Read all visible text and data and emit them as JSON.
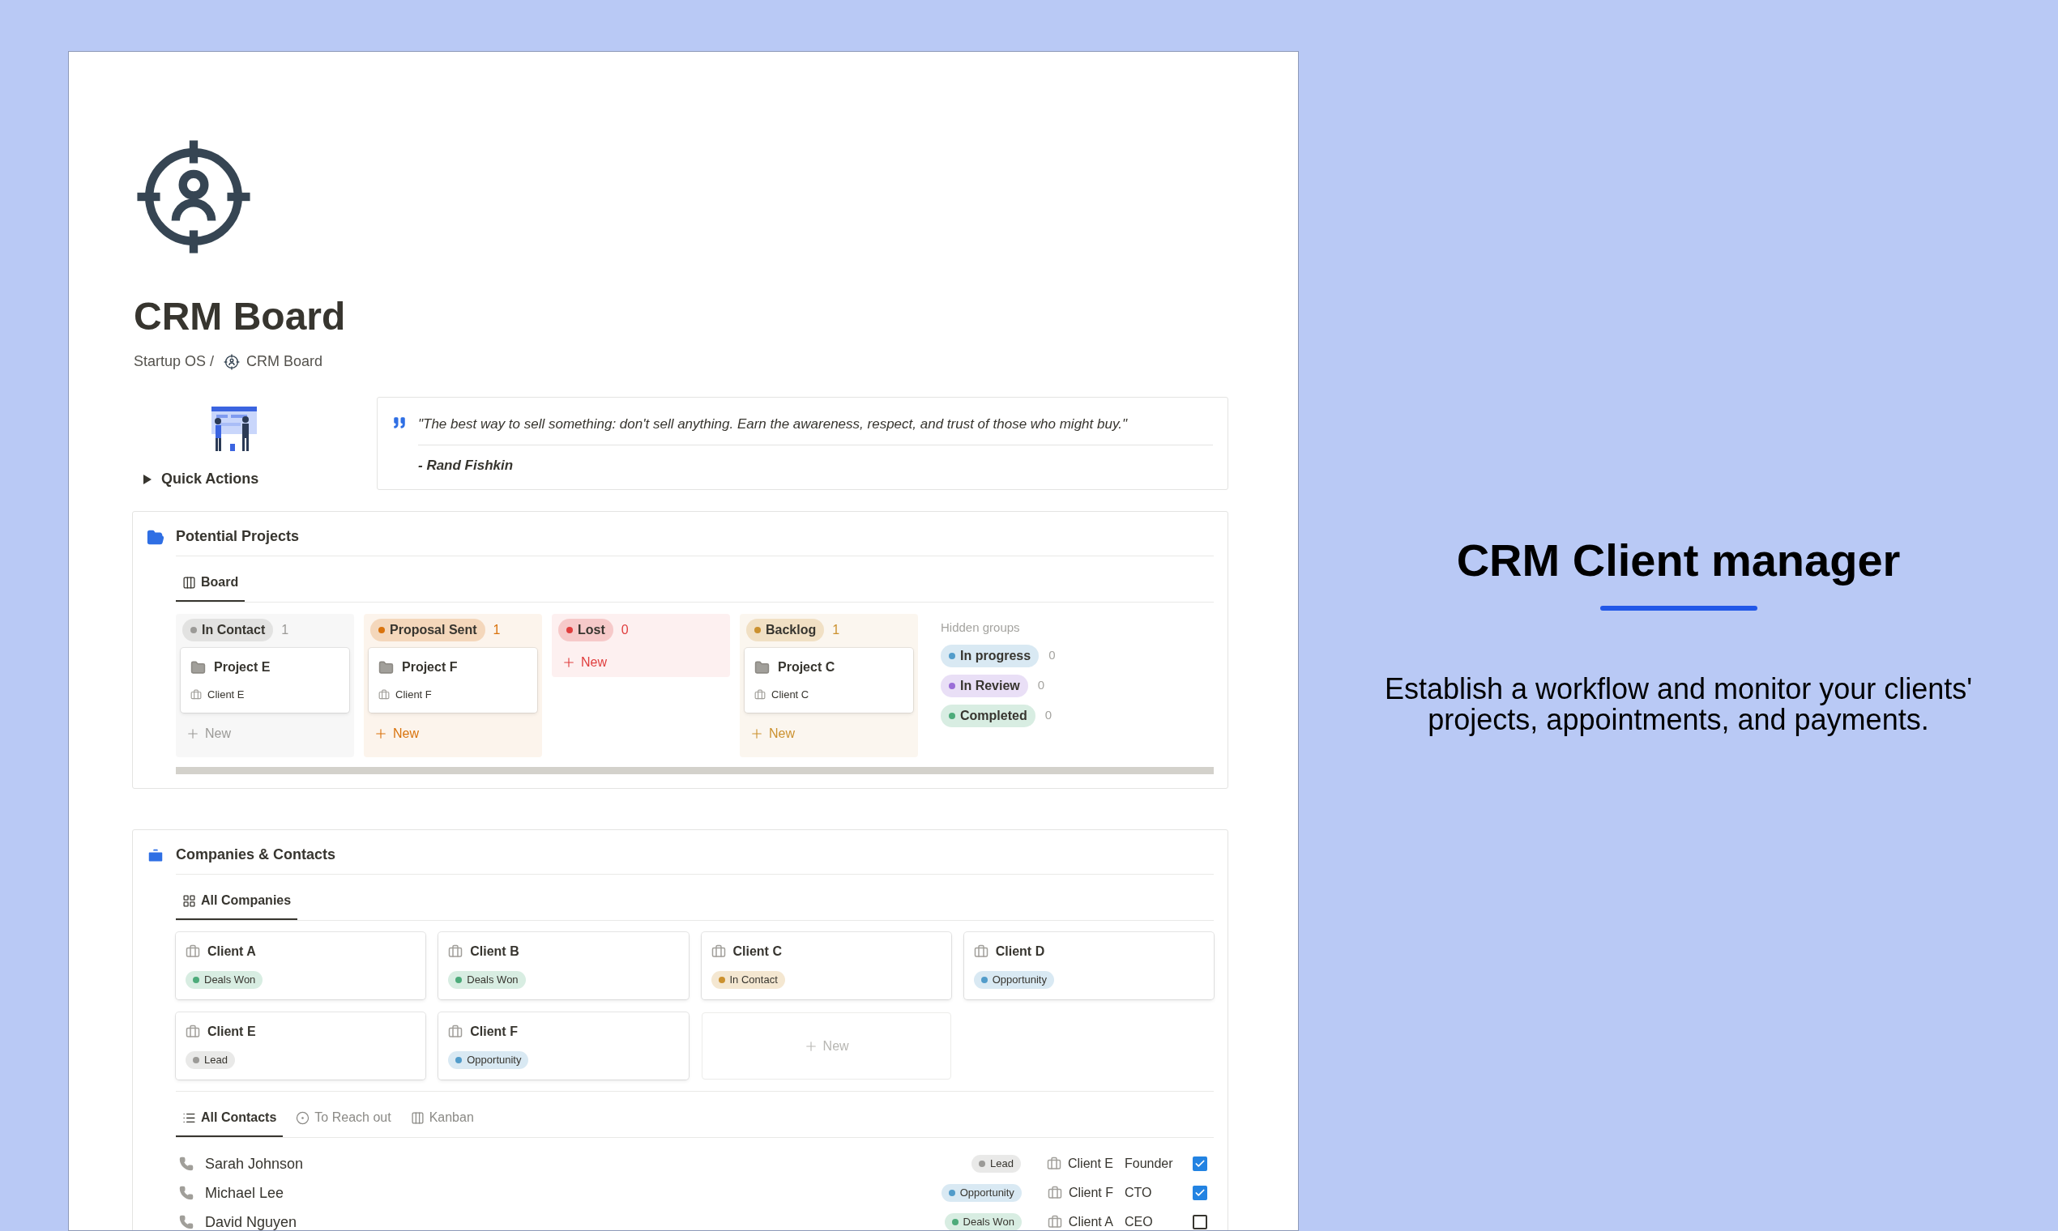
{
  "page": {
    "title": "CRM Board",
    "breadcrumb": [
      {
        "label": "Startup OS /"
      },
      {
        "label": "CRM Board"
      }
    ]
  },
  "quick_actions": {
    "label": "Quick Actions",
    "expanded": false
  },
  "quote": {
    "text": "\"The best way to sell something: don't sell anything. Earn the awareness, respect, and trust of those who might buy.\"",
    "author": "- Rand Fishkin"
  },
  "potential_projects": {
    "title": "Potential Projects",
    "views": [
      {
        "label": "Board",
        "selected": true
      }
    ],
    "groups": [
      {
        "label": "In Contact",
        "count": "1",
        "color": "#9b9a97",
        "cards": [
          {
            "title": "Project E",
            "client": "Client E"
          }
        ],
        "new_label": "New"
      },
      {
        "label": "Proposal Sent",
        "count": "1",
        "color": "#d9730d",
        "cards": [
          {
            "title": "Project F",
            "client": "Client F"
          }
        ],
        "new_label": "New"
      },
      {
        "label": "Lost",
        "count": "0",
        "color": "#e03e3e",
        "new_label": "New"
      },
      {
        "label": "Backlog",
        "count": "1",
        "color": "#cb912f",
        "cards": [
          {
            "title": "Project C",
            "client": "Client C"
          }
        ],
        "new_label": "New"
      }
    ],
    "hidden_groups": {
      "label": "Hidden groups",
      "groups": [
        {
          "label": "In progress",
          "count": "0",
          "color": "#529cca"
        },
        {
          "label": "In Review",
          "count": "0",
          "color": "#9a6dd7"
        },
        {
          "label": "Completed",
          "count": "0",
          "color": "#4dab7a"
        }
      ]
    }
  },
  "companies": {
    "title": "Companies & Contacts",
    "views": [
      {
        "label": "All Companies",
        "selected": true
      }
    ],
    "cards": [
      {
        "name": "Client A",
        "status": {
          "label": "Deals Won",
          "color": "#4dab7a"
        }
      },
      {
        "name": "Client B",
        "status": {
          "label": "Deals Won",
          "color": "#4dab7a"
        }
      },
      {
        "name": "Client C",
        "status": {
          "label": "In Contact",
          "color": "#cb912f"
        }
      },
      {
        "name": "Client D",
        "status": {
          "label": "Opportunity",
          "color": "#529cca"
        }
      },
      {
        "name": "Client E",
        "status": {
          "label": "Lead",
          "color": "#9b9a97"
        }
      },
      {
        "name": "Client F",
        "status": {
          "label": "Opportunity",
          "color": "#529cca"
        }
      }
    ],
    "new_label": "New"
  },
  "contacts": {
    "views": [
      {
        "label": "All Contacts",
        "selected": true,
        "kind": "list"
      },
      {
        "label": "To Reach out",
        "selected": false,
        "kind": "target"
      },
      {
        "label": "Kanban",
        "selected": false,
        "kind": "board"
      }
    ],
    "rows": [
      {
        "name": "Sarah Johnson",
        "status": {
          "label": "Lead",
          "color": "#9b9a97"
        },
        "company": "Client E",
        "role": "Founder",
        "checked": true
      },
      {
        "name": "Michael Lee",
        "status": {
          "label": "Opportunity",
          "color": "#529cca"
        },
        "company": "Client F",
        "role": "CTO",
        "checked": true
      },
      {
        "name": "David Nguyen",
        "status": {
          "label": "Deals Won",
          "color": "#4dab7a"
        },
        "company": "Client A",
        "role": "CEO",
        "checked": false
      }
    ]
  },
  "promo": {
    "title": "CRM Client manager",
    "text": "Establish a workflow and monitor your clients' projects, appointments, and payments."
  }
}
